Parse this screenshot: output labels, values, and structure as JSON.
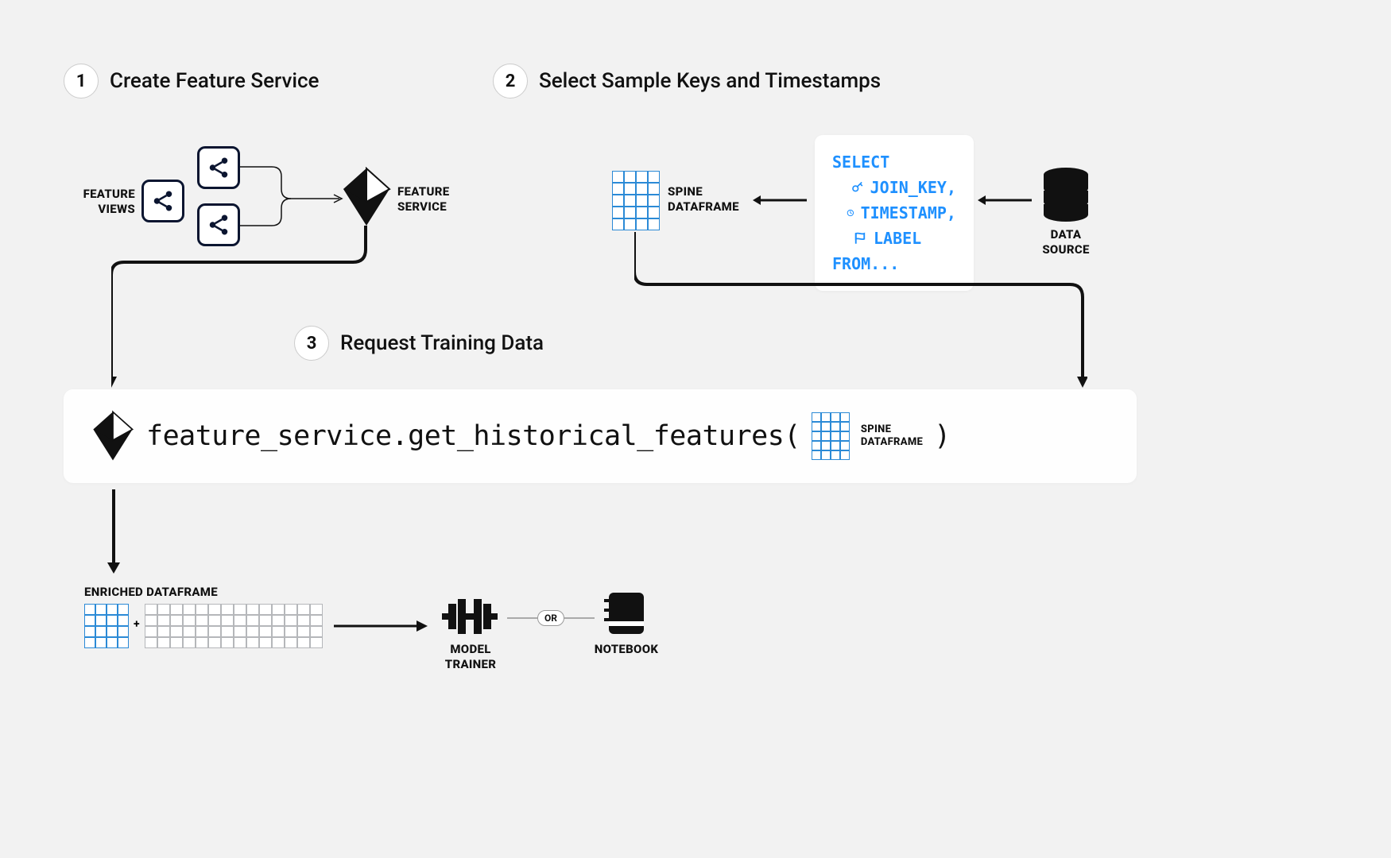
{
  "steps": {
    "s1": {
      "num": "1",
      "title": "Create Feature Service"
    },
    "s2": {
      "num": "2",
      "title": "Select Sample Keys and Timestamps"
    },
    "s3": {
      "num": "3",
      "title": "Request Training Data"
    }
  },
  "labels": {
    "feature_views": "FEATURE\nVIEWS",
    "feature_service": "FEATURE\nSERVICE",
    "spine_dataframe": "SPINE\nDATAFRAME",
    "spine_dataframe_inline": "SPINE\nDATAFRAME",
    "data_source": "DATA\nSOURCE",
    "enriched_dataframe": "ENRICHED DATAFRAME",
    "model_trainer": "MODEL\nTRAINER",
    "notebook": "NOTEBOOK",
    "or": "OR",
    "plus": "+"
  },
  "sql": {
    "select": "SELECT",
    "join_key": "JOIN_KEY,",
    "timestamp": "TIMESTAMP,",
    "label": "LABEL",
    "from": "FROM..."
  },
  "code": {
    "text": "feature_service.get_historical_features(",
    "close": ")"
  },
  "colors": {
    "blue": "#2b8ad6",
    "navy": "#0b1530",
    "gray": "#b5b7ba",
    "bg": "#f2f2f2"
  }
}
